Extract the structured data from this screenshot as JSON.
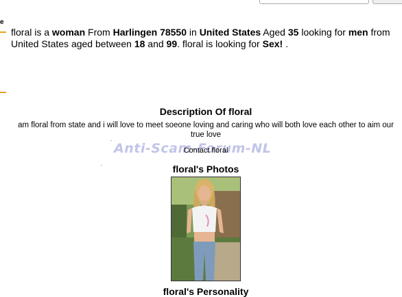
{
  "profile": {
    "name": "floral",
    "gender": "woman",
    "city": "Harlingen 78550",
    "country": "United States",
    "age": "35",
    "seeking": "men",
    "seeking_from": "United States",
    "age_min": "18",
    "age_max": "99",
    "intent": "Sex!"
  },
  "summary_text": {
    "p1": "floral is a ",
    "p2": " From ",
    "p3": " in ",
    "p4": " Aged ",
    "p5": " looking for ",
    "p6": " from ",
    "p7": " aged between ",
    "p8": " and ",
    "p9": ". floral is looking for ",
    "p10": " ."
  },
  "edge_char": "e",
  "description": {
    "heading": "Description Of floral",
    "text": "am floral from state and i will love to meet soeone loving and caring who will both love each other to aim our true love"
  },
  "contact_label": "Contact floral",
  "watermark": "Anti-Scam-Forum-NL",
  "photos_heading": "floral's Photos",
  "personality_heading": "floral's Personality",
  "colors": {
    "accent_dash": "#e8a020",
    "watermark": "#c2c5e8"
  }
}
